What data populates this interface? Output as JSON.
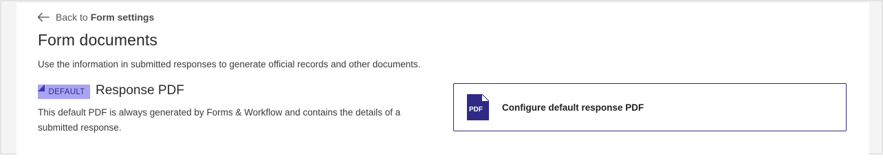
{
  "back_link": {
    "prefix": "Back to",
    "target": "Form settings",
    "icon": "arrow-left-icon"
  },
  "page": {
    "title": "Form documents",
    "description": "Use the information in submitted responses to generate official records and other documents."
  },
  "response_pdf": {
    "badge": "DEFAULT",
    "title": "Response PDF",
    "description": "This default PDF is always generated by Forms & Workflow and contains the details of a submitted response."
  },
  "config_card": {
    "label": "Configure default response PDF",
    "icon": "pdf-file-icon",
    "icon_text": "PDF"
  },
  "colors": {
    "accent": "#2d2a7a",
    "badge_bg": "#a9a4f2",
    "badge_text": "#2f2a8c",
    "pdf_icon": "#2e2a86"
  }
}
